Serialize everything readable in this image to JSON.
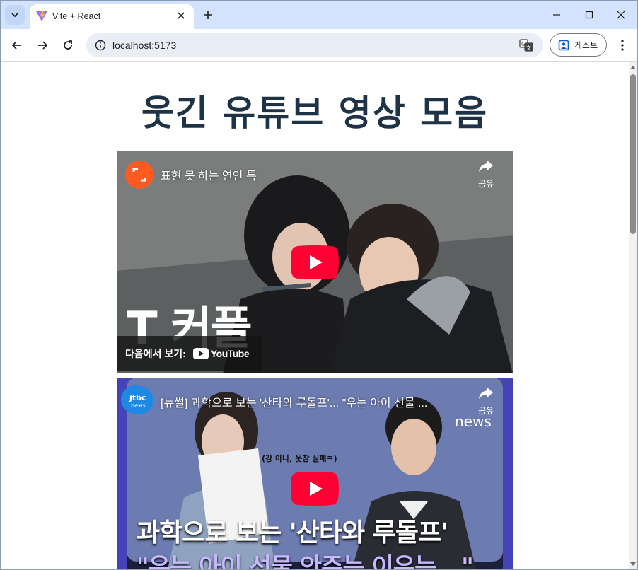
{
  "browser": {
    "tab_title": "Vite + React",
    "url": "localhost:5173",
    "profile_label": "게스트"
  },
  "page": {
    "title": "웃긴 유튜브 영상 모음"
  },
  "videos": [
    {
      "title": "표현 못 하는 연인 특",
      "share_label": "공유",
      "watch_on_label": "다음에서 보기:",
      "youtube_label": "YouTube",
      "thumb_caption": "T 커플"
    },
    {
      "title": "[뉴썰] 과학으로 보는 '산타와 루돌프'... \"우는 아이 선물 ...",
      "share_label": "공유",
      "channel_label": "news",
      "thumb_subtitle": "(강 아나, 웃참 실패ㅋ)",
      "thumb_caption": "과학으로 보는 '산타와 루돌프'",
      "thumb_caption2": "\"우는 아이 선물 안주는 이유는...\""
    }
  ],
  "colors": {
    "tabstrip": "#d3e3fd",
    "title": "#1f3347",
    "youtube_red": "#ff0033",
    "channel1": "#ff5a1f",
    "channel2": "#1e88e5"
  }
}
